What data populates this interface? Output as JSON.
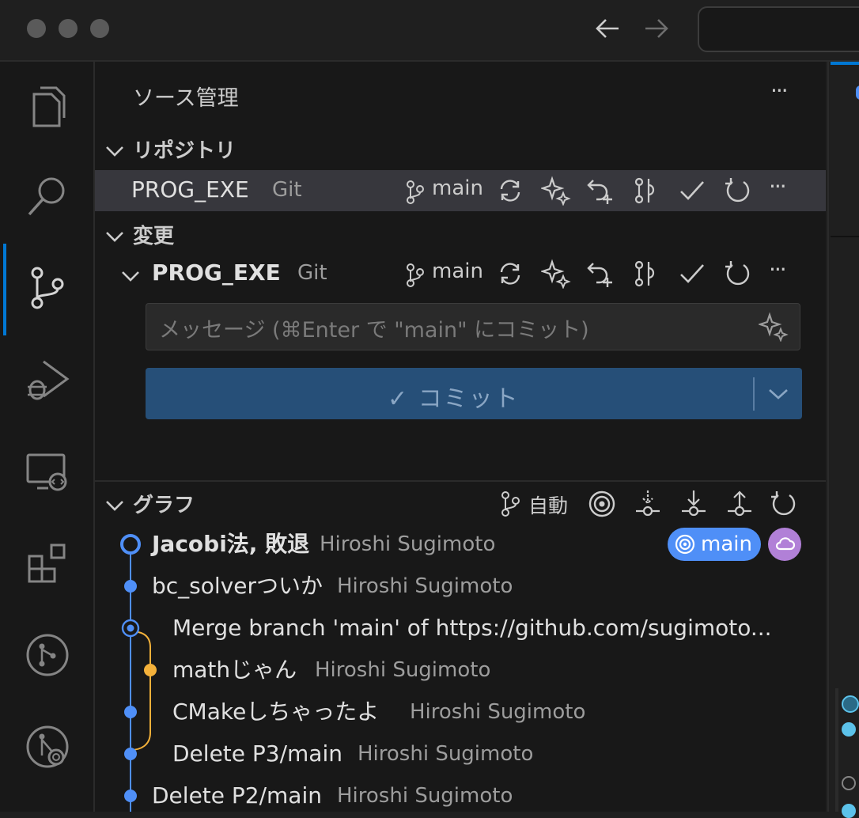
{
  "window": {
    "back_icon": "arrow-left-icon",
    "forward_icon": "arrow-right-icon"
  },
  "activity_bar": [
    "files-icon",
    "search-icon",
    "source-control-icon",
    "run-debug-icon",
    "remote-explorer-icon",
    "extensions-icon",
    "github-icon",
    "git-lens-icon"
  ],
  "panel": {
    "title": "ソース管理",
    "more": "···",
    "repos_header": "リポジトリ",
    "repo": {
      "name": "PROG_EXE",
      "type": "Git",
      "branch": "main",
      "more": "···"
    },
    "changes_header": "変更",
    "changes_repo": {
      "name": "PROG_EXE",
      "type": "Git",
      "branch": "main",
      "more": "···"
    },
    "message_placeholder": "メッセージ (⌘Enter で \"main\" にコミット)",
    "commit_button": "✓ コミット",
    "graph_header": "グラフ",
    "graph_auto": "自動",
    "graph_branch_badge": "main",
    "commits": [
      {
        "message": "Jacobi法, 敗退",
        "author": "Hiroshi Sugimoto"
      },
      {
        "message": "bc_solverついか",
        "author": "Hiroshi Sugimoto"
      },
      {
        "message": "Merge branch 'main' of https://github.com/sugimoto...",
        "author": ""
      },
      {
        "message": "mathじゃん",
        "author": "Hiroshi Sugimoto"
      },
      {
        "message": "CMakeしちゃったよ",
        "author": "Hiroshi Sugimoto"
      },
      {
        "message": "Delete P3/main",
        "author": "Hiroshi Sugimoto"
      },
      {
        "message": "Delete P2/main",
        "author": "Hiroshi Sugimoto"
      }
    ]
  },
  "colors": {
    "accent": "#0078d4",
    "commit_button_bg": "#264f78",
    "graph_blue": "#4f8ff7",
    "graph_yellow": "#f4b13a",
    "badge_purple": "#b180d7"
  }
}
